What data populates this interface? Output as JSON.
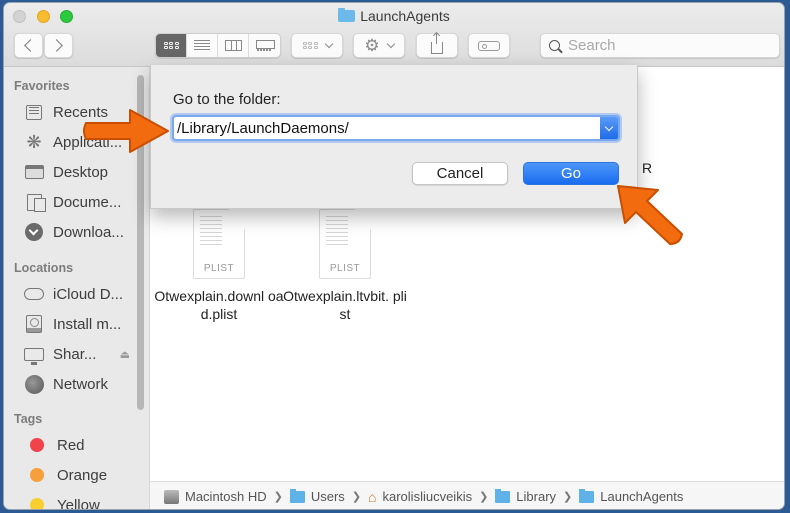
{
  "window": {
    "title": "LaunchAgents",
    "title_icon": "folder-icon"
  },
  "toolbar": {
    "back_icon": "chevron-left-icon",
    "forward_icon": "chevron-right-icon",
    "view_modes": [
      {
        "name": "icon-view",
        "active": true
      },
      {
        "name": "list-view",
        "active": false
      },
      {
        "name": "column-view",
        "active": false
      },
      {
        "name": "gallery-view",
        "active": false
      }
    ],
    "group_icon": "group-by-icon",
    "action_icon": "gear-icon",
    "share_icon": "share-icon",
    "tag_icon": "tag-icon",
    "search": {
      "placeholder": "Search",
      "value": ""
    }
  },
  "sidebar": {
    "favorites_header": "Favorites",
    "favorites": [
      {
        "label": "Recents",
        "icon": "recents-icon"
      },
      {
        "label": "Applicati...",
        "icon": "applications-icon"
      },
      {
        "label": "Desktop",
        "icon": "desktop-icon"
      },
      {
        "label": "Docume...",
        "icon": "documents-icon"
      },
      {
        "label": "Downloa...",
        "icon": "downloads-icon"
      }
    ],
    "locations_header": "Locations",
    "locations": [
      {
        "label": "iCloud D...",
        "icon": "icloud-icon"
      },
      {
        "label": "Install m...",
        "icon": "disk-icon"
      },
      {
        "label": "Shar...",
        "icon": "display-icon",
        "eject": true
      },
      {
        "label": "Network",
        "icon": "network-icon"
      }
    ],
    "tags_header": "Tags",
    "tags": [
      {
        "label": "Red",
        "color": "#f0434a"
      },
      {
        "label": "Orange",
        "color": "#f7a03b"
      },
      {
        "label": "Yellow",
        "color": "#f8cf2e"
      }
    ]
  },
  "files": [
    {
      "name": "Otwexplain.download.plist",
      "display": "Otwexplain.downl oad.plist",
      "type": "PLIST"
    },
    {
      "name": "Otwexplain.ltvbit.plist",
      "display": "Otwexplain.ltvbit. plist",
      "type": "PLIST"
    }
  ],
  "partial_label": "R",
  "dialog": {
    "label": "Go to the folder:",
    "path_value": "/Library/LaunchDaemons/",
    "cancel_label": "Cancel",
    "go_label": "Go"
  },
  "pathbar": [
    {
      "label": "Macintosh HD",
      "icon": "hard-drive-icon"
    },
    {
      "label": "Users",
      "icon": "users-folder-icon"
    },
    {
      "label": "karolisliucveikis",
      "icon": "home-icon"
    },
    {
      "label": "Library",
      "icon": "library-folder-icon"
    },
    {
      "label": "LaunchAgents",
      "icon": "folder-icon"
    }
  ],
  "annotations": {
    "arrow_color": "#f26b0f"
  }
}
